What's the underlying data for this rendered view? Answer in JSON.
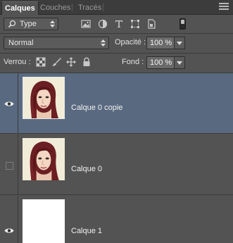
{
  "tabs": [
    {
      "label": "Calques",
      "active": true
    },
    {
      "label": "Couches",
      "active": false
    },
    {
      "label": "Tracés",
      "active": false
    }
  ],
  "filter": {
    "kind_value": "Type"
  },
  "blend": {
    "mode_value": "Normal"
  },
  "opacity": {
    "label": "Opacité :",
    "value": "100 %"
  },
  "lock": {
    "label": "Verrou :"
  },
  "fill": {
    "label": "Fond :",
    "value": "100 %"
  },
  "layers": [
    {
      "name": "Calque 0 copie",
      "visible": true,
      "selected": true
    },
    {
      "name": "Calque 0",
      "visible": false,
      "selected": false
    },
    {
      "name": "Calque 1",
      "visible": true,
      "selected": false
    }
  ],
  "colors": {
    "panel": "#535353",
    "selected_row": "#596a80",
    "tabbar": "#3c3c3c",
    "hair": "#6b1f22"
  }
}
